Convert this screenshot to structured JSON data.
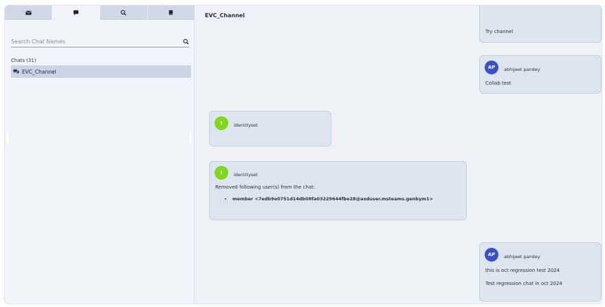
{
  "tabs": [
    {
      "icon": "mail-icon"
    },
    {
      "icon": "chat-bubble-icon"
    },
    {
      "icon": "search-icon"
    },
    {
      "icon": "book-icon"
    }
  ],
  "search": {
    "placeholder": "Search Chat Names"
  },
  "chats": {
    "header": "Chats (31)",
    "items": [
      {
        "label": "EVC_Channel",
        "icon": "chat-group-icon"
      }
    ]
  },
  "channel": {
    "title": "EVC_Channel"
  },
  "messages": [
    {
      "text": "Try channel"
    },
    {
      "avatar": "AP",
      "timestamp": "",
      "sender": "abhijeet pandey",
      "lines": [
        "Collab test"
      ]
    },
    {
      "avatar": "I",
      "timestamp": "",
      "sender": "identityset",
      "lines": []
    },
    {
      "avatar": "I",
      "timestamp": "",
      "sender": "identityset",
      "lines": [
        "Removed following user(s) from the chat:"
      ],
      "bullets": [
        "member <7edb9e0751d14db08fa03229644fbe28@axduser.msteams.genbym1>"
      ]
    },
    {
      "avatar": "AP",
      "timestamp": "",
      "sender": "abhijeet pandey",
      "lines": [
        "this is oct regression test 2024",
        "Test regression chat in oct 2024"
      ]
    }
  ],
  "colors": {
    "accent_avatar": "#3d4fc8",
    "identity_avatar": "#7fd61b",
    "selected_chat": "#c9d5e4"
  }
}
